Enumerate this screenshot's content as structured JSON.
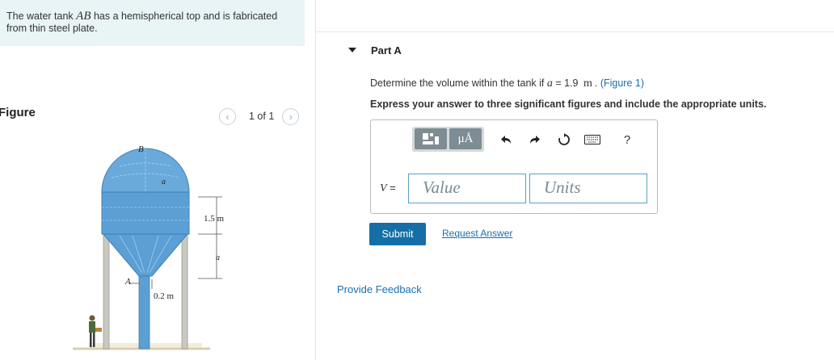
{
  "problem": {
    "prefix": "The water tank ",
    "symbol": "AB",
    "suffix": " has a hemispherical top and is fabricated from thin steel plate."
  },
  "figure": {
    "heading": "Figure",
    "pager_text": "1 of 1",
    "prev_icon": "chevron-left-icon",
    "next_icon": "chevron-right-icon",
    "labels": {
      "point_b": "B",
      "point_a": "A",
      "dim_a_top": "a",
      "dim_height": "1.5 m",
      "dim_a_side": "a",
      "dim_pipe": "0.2 m"
    }
  },
  "part": {
    "title": "Part A",
    "question_prefix": "Determine the volume within the tank if ",
    "question_var": "a",
    "question_eq": " = 1.9 ",
    "question_unit": "m",
    "question_sep": ".",
    "figure_link": "(Figure 1)",
    "instruction": "Express your answer to three significant figures and include the appropriate units."
  },
  "answer": {
    "toolbar": {
      "template_icon": "templates-icon",
      "units_button": "μÅ",
      "undo_icon": "undo-icon",
      "redo_icon": "redo-icon",
      "reset_icon": "reset-icon",
      "keyboard_icon": "keyboard-icon",
      "help": "?"
    },
    "var_label": "V",
    "equals": " =",
    "value_placeholder": "Value",
    "units_placeholder": "Units"
  },
  "actions": {
    "submit": "Submit",
    "request": "Request Answer",
    "feedback": "Provide Feedback"
  },
  "colors": {
    "accent": "#166ea6",
    "link": "#1a6fb0",
    "problem_bg": "#e8f4f6",
    "tank": "#5b9fd4"
  }
}
